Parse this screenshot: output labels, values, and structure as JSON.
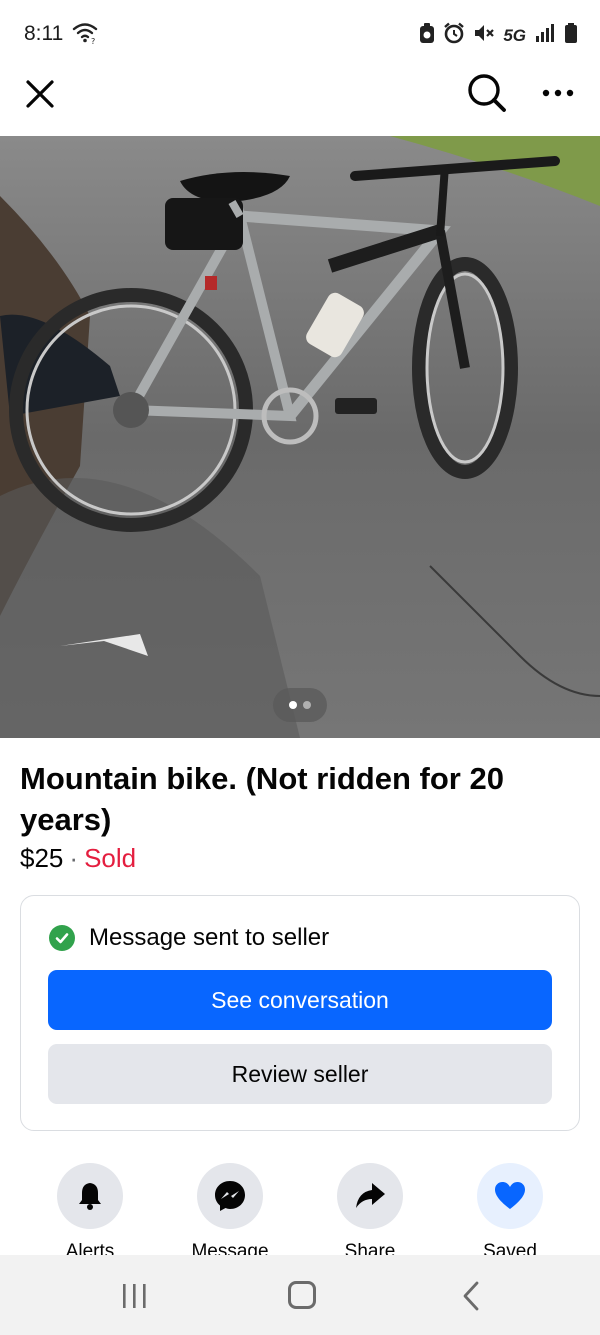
{
  "status_bar": {
    "time": "8:11",
    "network": "5G",
    "icons": [
      "wifi-icon",
      "messenger-icon",
      "alarm-icon",
      "mute-icon",
      "signal-icon",
      "battery-icon"
    ]
  },
  "nav": {
    "icons": [
      "close-icon",
      "search-icon",
      "more-icon"
    ]
  },
  "photo": {
    "subject": "mountain bike",
    "pager_total": 2,
    "pager_active": 1
  },
  "listing": {
    "title": "Mountain bike. (Not ridden for 20 years)",
    "price": "$25",
    "separator": "·",
    "status": "Sold"
  },
  "message_card": {
    "status_text": "Message sent to seller",
    "primary_button": "See conversation",
    "secondary_button": "Review seller"
  },
  "actions": [
    {
      "label": "Alerts",
      "icon": "bell-icon"
    },
    {
      "label": "Message",
      "icon": "messenger-icon"
    },
    {
      "label": "Share",
      "icon": "share-icon"
    },
    {
      "label": "Saved",
      "icon": "heart-icon"
    }
  ],
  "colors": {
    "primary": "#0866ff",
    "sold": "#e41e3f",
    "success": "#31a24c",
    "saved_icon": "#0866ff",
    "secondary_button": "#e4e6eb"
  },
  "system_nav": {
    "icons": [
      "recents-icon",
      "home-icon",
      "back-icon"
    ]
  }
}
